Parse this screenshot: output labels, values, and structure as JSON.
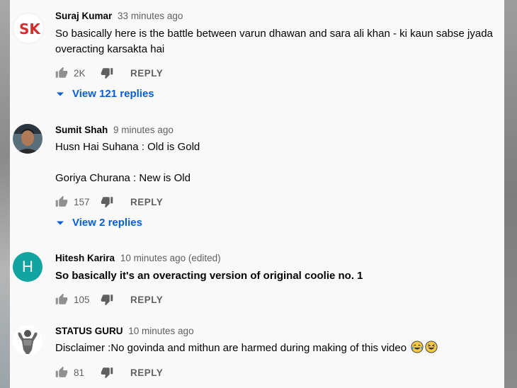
{
  "comments": [
    {
      "author": "Suraj Kumar",
      "time": "33 minutes ago",
      "text": "So basically here is the battle between varun dhawan and sara ali khan - ki kaun sabse jyada overacting karsakta hai",
      "likes": "2K",
      "reply_label": "REPLY",
      "view_replies": "View 121 replies",
      "avatar_text": "SK"
    },
    {
      "author": "Sumit Shah",
      "time": "9 minutes ago",
      "text": "Husn Hai Suhana : Old is Gold\n\nGoriya Churana : New is Old",
      "likes": "157",
      "reply_label": "REPLY",
      "view_replies": "View 2 replies"
    },
    {
      "author": "Hitesh Karira",
      "time": "10 minutes ago (edited)",
      "text": "So basically it's an overacting version of original coolie no. 1",
      "likes": "105",
      "reply_label": "REPLY",
      "avatar_letter": "H",
      "avatar_color": "#12a4a0"
    },
    {
      "author": "STATUS GURU",
      "time": "10 minutes ago",
      "text": "Disclaimer :No govinda and mithun are harmed during making of this video",
      "likes": "81",
      "reply_label": "REPLY"
    }
  ],
  "colors": {
    "link": "#065fd4",
    "meta": "#606060",
    "text": "#030303"
  }
}
